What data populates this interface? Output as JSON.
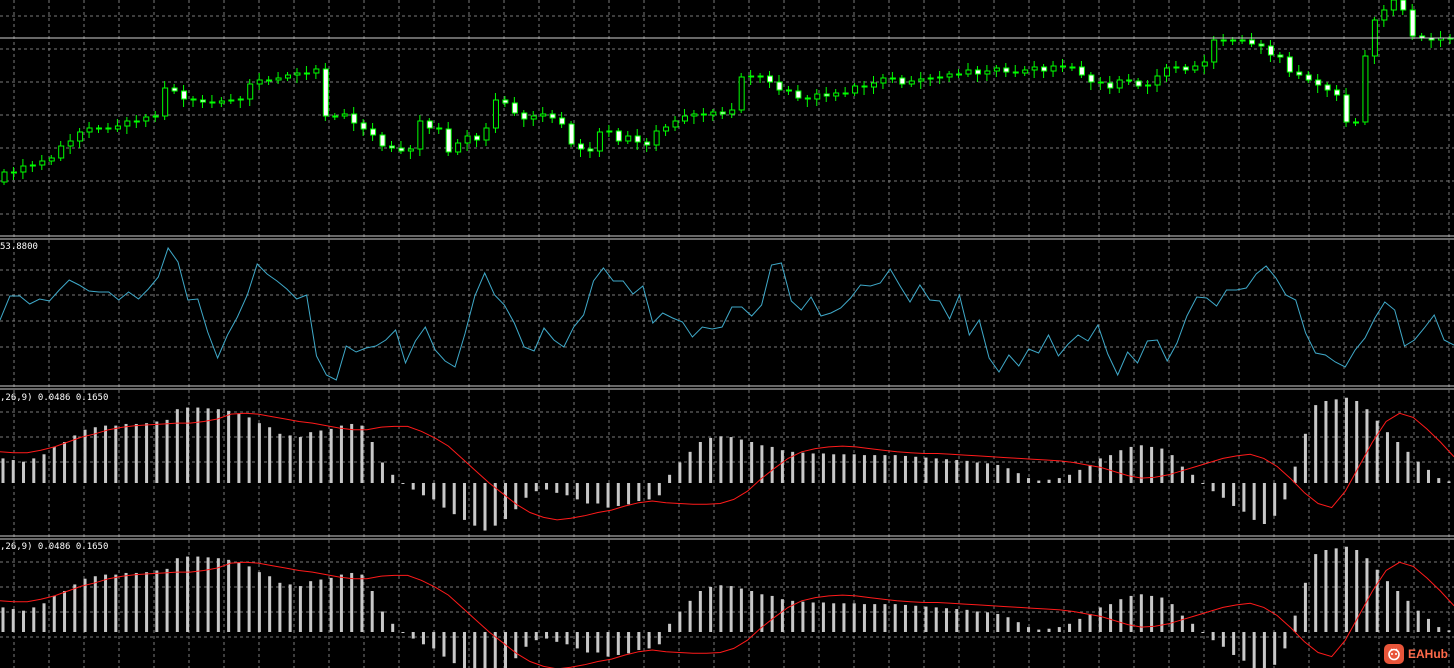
{
  "colors": {
    "background": "#000000",
    "grid": "#7a7a7a",
    "separator": "#d0d0d0",
    "bull_candle": "#00ff00",
    "bear_candle": "#ffffff",
    "rsi_line": "#3fa9c9",
    "histogram": "#c8c8c8",
    "signal_line": "#ff1a1a",
    "watermark": "#ff6a4a"
  },
  "panes": {
    "rsi": {
      "label": "53.8800"
    },
    "macd1": {
      "label": ",26,9) 0.0486 0.1650"
    },
    "macd2": {
      "label": ",26,9) 0.0486 0.1650"
    }
  },
  "watermark": {
    "text": "EAHub",
    "icon": "eahub-logo-icon"
  },
  "chart_data": [
    {
      "type": "candlestick",
      "pane": "price",
      "grid": true,
      "close": [
        172,
        172,
        166,
        165,
        161,
        158,
        146,
        141,
        132,
        128,
        128,
        129,
        126,
        121,
        121,
        117,
        116,
        88,
        91,
        99,
        100,
        102,
        103,
        101,
        100,
        99,
        84,
        80,
        80,
        78,
        75,
        73,
        73,
        69,
        116,
        116,
        114,
        123,
        129,
        135,
        146,
        148,
        151,
        149,
        121,
        128,
        129,
        152,
        143,
        136,
        140,
        128,
        100,
        103,
        113,
        119,
        116,
        114,
        118,
        124,
        144,
        149,
        151,
        132,
        131,
        141,
        136,
        142,
        145,
        131,
        127,
        121,
        116,
        114,
        115,
        112,
        114,
        110,
        77,
        76,
        76,
        82,
        90,
        91,
        98,
        99,
        94,
        96,
        93,
        93,
        86,
        87,
        83,
        78,
        78,
        84,
        81,
        79,
        78,
        77,
        74,
        74,
        70,
        74,
        71,
        68,
        72,
        73,
        70,
        67,
        71,
        66,
        67,
        67,
        75,
        82,
        83,
        88,
        80,
        81,
        86,
        85,
        76,
        68,
        67,
        70,
        66,
        62,
        40,
        40,
        40,
        40,
        44,
        46,
        55,
        57,
        72,
        75,
        80,
        85,
        90,
        95,
        122,
        122,
        56,
        20,
        10,
        0,
        10,
        36,
        38,
        40,
        38,
        38
      ]
    },
    {
      "type": "line",
      "pane": "rsi",
      "series": [
        {
          "values": [
            320,
            296,
            296,
            304,
            299,
            301,
            290,
            280,
            285,
            291,
            292,
            292,
            300,
            292,
            299,
            289,
            277,
            248,
            262,
            300,
            299,
            332,
            358,
            335,
            317,
            295,
            264,
            274,
            281,
            289,
            299,
            295,
            356,
            375,
            380,
            346,
            352,
            348,
            346,
            340,
            330,
            363,
            341,
            327,
            350,
            361,
            367,
            334,
            296,
            273,
            295,
            305,
            323,
            347,
            351,
            328,
            340,
            347,
            327,
            315,
            281,
            268,
            281,
            281,
            294,
            286,
            323,
            313,
            318,
            322,
            337,
            327,
            329,
            327,
            307,
            307,
            316,
            305,
            265,
            263,
            301,
            310,
            297,
            316,
            313,
            308,
            298,
            285,
            286,
            283,
            269,
            286,
            302,
            285,
            300,
            301,
            319,
            295,
            335,
            320,
            358,
            372,
            355,
            366,
            349,
            353,
            335,
            356,
            344,
            335,
            341,
            325,
            354,
            375,
            352,
            363,
            341,
            340,
            361,
            343,
            316,
            297,
            298,
            306,
            290,
            290,
            288,
            274,
            266,
            278,
            295,
            300,
            333,
            353,
            355,
            362,
            367,
            350,
            338,
            318,
            302,
            310,
            346,
            340,
            328,
            315,
            340,
            345
          ]
        }
      ]
    },
    {
      "type": "bar",
      "pane": "macd1",
      "series": [
        {
          "values": [
            0.3,
            0.28,
            0.26,
            0.3,
            0.35,
            0.44,
            0.5,
            0.58,
            0.65,
            0.68,
            0.7,
            0.7,
            0.72,
            0.72,
            0.73,
            0.75,
            0.77,
            0.9,
            0.92,
            0.92,
            0.91,
            0.9,
            0.88,
            0.85,
            0.8,
            0.73,
            0.68,
            0.6,
            0.58,
            0.56,
            0.62,
            0.64,
            0.66,
            0.7,
            0.72,
            0.7,
            0.5,
            0.25,
            0.1,
            0.0,
            -0.08,
            -0.15,
            -0.2,
            -0.3,
            -0.38,
            -0.45,
            -0.52,
            -0.58,
            -0.52,
            -0.44,
            -0.32,
            -0.18,
            -0.1,
            -0.08,
            -0.12,
            -0.15,
            -0.2,
            -0.25,
            -0.25,
            -0.3,
            -0.28,
            -0.26,
            -0.22,
            -0.2,
            -0.15,
            0.1,
            0.25,
            0.38,
            0.5,
            0.55,
            0.57,
            0.56,
            0.53,
            0.5,
            0.46,
            0.44,
            0.4,
            0.38,
            0.37,
            0.36,
            0.36,
            0.35,
            0.35,
            0.35,
            0.34,
            0.34,
            0.34,
            0.34,
            0.33,
            0.32,
            0.31,
            0.3,
            0.29,
            0.28,
            0.27,
            0.25,
            0.24,
            0.22,
            0.18,
            0.12,
            0.06,
            0.03,
            0.04,
            0.06,
            0.1,
            0.16,
            0.22,
            0.3,
            0.34,
            0.4,
            0.44,
            0.46,
            0.44,
            0.42,
            0.34,
            0.2,
            0.1,
            0.0,
            -0.1,
            -0.18,
            -0.28,
            -0.35,
            -0.45,
            -0.5,
            -0.4,
            -0.2,
            0.2,
            0.6,
            0.95,
            1.0,
            1.02,
            1.04,
            1.0,
            0.9,
            0.76,
            0.62,
            0.5,
            0.38,
            0.26,
            0.16,
            0.06,
            0.02
          ]
        },
        {
          "values": [
            0.38,
            0.37,
            0.37,
            0.4,
            0.44,
            0.5,
            0.56,
            0.6,
            0.65,
            0.68,
            0.7,
            0.71,
            0.72,
            0.73,
            0.73,
            0.75,
            0.78,
            0.84,
            0.85,
            0.84,
            0.81,
            0.78,
            0.75,
            0.73,
            0.7,
            0.67,
            0.65,
            0.65,
            0.68,
            0.69,
            0.69,
            0.63,
            0.55,
            0.45,
            0.3,
            0.15,
            0.0,
            -0.13,
            -0.26,
            -0.36,
            -0.42,
            -0.45,
            -0.43,
            -0.4,
            -0.36,
            -0.33,
            -0.28,
            -0.24,
            -0.22,
            -0.24,
            -0.25,
            -0.26,
            -0.26,
            -0.25,
            -0.2,
            -0.1,
            0.05,
            0.18,
            0.3,
            0.38,
            0.42,
            0.44,
            0.45,
            0.44,
            0.42,
            0.4,
            0.38,
            0.37,
            0.36,
            0.36,
            0.35,
            0.34,
            0.33,
            0.32,
            0.31,
            0.3,
            0.29,
            0.28,
            0.27,
            0.25,
            0.22,
            0.19,
            0.14,
            0.09,
            0.06,
            0.07,
            0.1,
            0.15,
            0.2,
            0.25,
            0.3,
            0.33,
            0.35,
            0.3,
            0.2,
            0.05,
            -0.12,
            -0.25,
            -0.3,
            -0.1,
            0.2,
            0.5,
            0.75,
            0.85,
            0.8,
            0.66,
            0.5,
            0.32
          ]
        }
      ]
    },
    {
      "type": "bar",
      "pane": "macd2",
      "series": [
        {
          "values": [
            0.3,
            0.28,
            0.26,
            0.3,
            0.35,
            0.44,
            0.5,
            0.58,
            0.65,
            0.68,
            0.7,
            0.7,
            0.72,
            0.72,
            0.73,
            0.75,
            0.77,
            0.9,
            0.92,
            0.92,
            0.91,
            0.9,
            0.88,
            0.85,
            0.8,
            0.73,
            0.68,
            0.6,
            0.58,
            0.56,
            0.62,
            0.64,
            0.66,
            0.7,
            0.72,
            0.7,
            0.5,
            0.25,
            0.1,
            0.0,
            -0.08,
            -0.15,
            -0.2,
            -0.3,
            -0.38,
            -0.45,
            -0.52,
            -0.58,
            -0.52,
            -0.44,
            -0.32,
            -0.18,
            -0.1,
            -0.08,
            -0.12,
            -0.15,
            -0.2,
            -0.25,
            -0.25,
            -0.3,
            -0.28,
            -0.26,
            -0.22,
            -0.2,
            -0.15,
            0.1,
            0.25,
            0.38,
            0.5,
            0.55,
            0.57,
            0.56,
            0.53,
            0.5,
            0.46,
            0.44,
            0.4,
            0.38,
            0.37,
            0.36,
            0.36,
            0.35,
            0.35,
            0.35,
            0.34,
            0.34,
            0.34,
            0.34,
            0.33,
            0.32,
            0.31,
            0.3,
            0.29,
            0.28,
            0.27,
            0.25,
            0.24,
            0.22,
            0.18,
            0.12,
            0.06,
            0.03,
            0.04,
            0.06,
            0.1,
            0.16,
            0.22,
            0.3,
            0.34,
            0.4,
            0.44,
            0.46,
            0.44,
            0.42,
            0.34,
            0.2,
            0.1,
            0.0,
            -0.1,
            -0.18,
            -0.28,
            -0.35,
            -0.45,
            -0.5,
            -0.4,
            -0.2,
            0.2,
            0.6,
            0.95,
            1.0,
            1.02,
            1.04,
            1.0,
            0.9,
            0.76,
            0.62,
            0.5,
            0.38,
            0.26,
            0.16,
            0.06,
            0.02
          ]
        },
        {
          "values": [
            0.38,
            0.37,
            0.37,
            0.4,
            0.44,
            0.5,
            0.56,
            0.6,
            0.65,
            0.68,
            0.7,
            0.71,
            0.72,
            0.73,
            0.73,
            0.75,
            0.78,
            0.84,
            0.85,
            0.84,
            0.81,
            0.78,
            0.75,
            0.73,
            0.7,
            0.67,
            0.65,
            0.65,
            0.68,
            0.69,
            0.69,
            0.63,
            0.55,
            0.45,
            0.3,
            0.15,
            0.0,
            -0.13,
            -0.26,
            -0.36,
            -0.42,
            -0.45,
            -0.43,
            -0.4,
            -0.36,
            -0.33,
            -0.28,
            -0.24,
            -0.22,
            -0.24,
            -0.25,
            -0.26,
            -0.26,
            -0.25,
            -0.2,
            -0.1,
            0.05,
            0.18,
            0.3,
            0.38,
            0.42,
            0.44,
            0.45,
            0.44,
            0.42,
            0.4,
            0.38,
            0.37,
            0.36,
            0.36,
            0.35,
            0.34,
            0.33,
            0.32,
            0.31,
            0.3,
            0.29,
            0.28,
            0.27,
            0.25,
            0.22,
            0.19,
            0.14,
            0.09,
            0.06,
            0.07,
            0.1,
            0.15,
            0.2,
            0.25,
            0.3,
            0.33,
            0.35,
            0.3,
            0.2,
            0.05,
            -0.12,
            -0.25,
            -0.3,
            -0.1,
            0.2,
            0.5,
            0.75,
            0.85,
            0.8,
            0.66,
            0.5,
            0.32
          ]
        }
      ]
    }
  ]
}
